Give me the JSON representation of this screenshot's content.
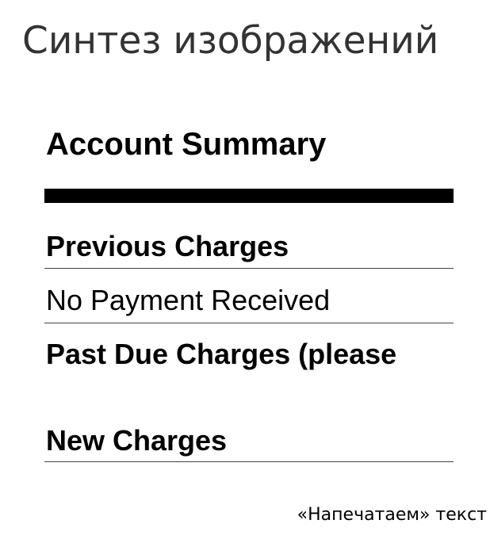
{
  "slide": {
    "title": "Синтез изображений",
    "caption": "«Напечатаем» текст"
  },
  "rendered_text": {
    "heading": "Account Summary",
    "rows": [
      {
        "label": "Previous Charges"
      },
      {
        "label": "No Payment Received"
      },
      {
        "label": "Past Due Charges (please"
      },
      {
        "label": "New Charges"
      }
    ]
  }
}
